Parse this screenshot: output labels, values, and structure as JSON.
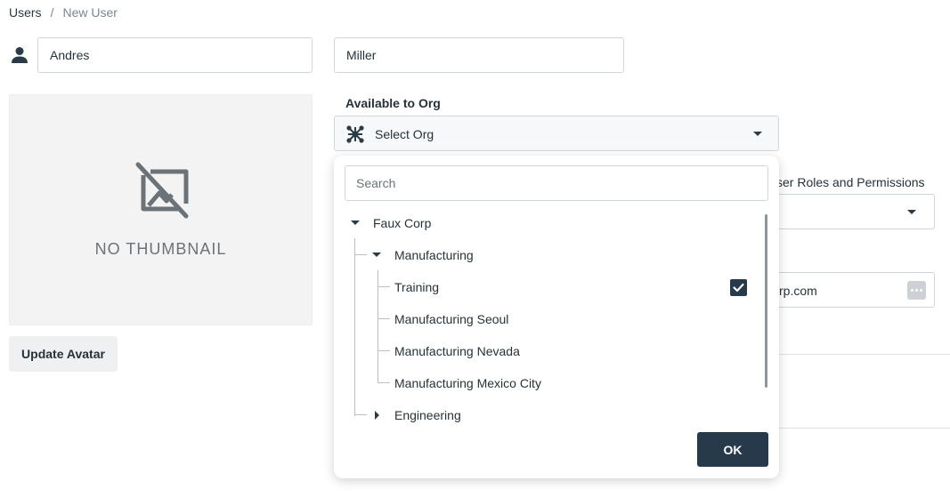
{
  "breadcrumb": {
    "root": "Users",
    "separator": "/",
    "current": "New User"
  },
  "user": {
    "first_name": "Andres",
    "last_name": "Miller"
  },
  "thumbnail": {
    "placeholder_text": "NO THUMBNAIL",
    "icon": "no-image-icon"
  },
  "avatar": {
    "update_label": "Update Avatar"
  },
  "org": {
    "label": "Available to Org",
    "select_placeholder": "Select Org",
    "icon": "org-network-icon"
  },
  "background": {
    "roles_label": "ser Roles and Permissions",
    "email_fragment": "rp.com"
  },
  "org_popup": {
    "search_placeholder": "Search",
    "tree": [
      {
        "label": "Faux Corp",
        "level": 0,
        "expanded": true,
        "checked": false
      },
      {
        "label": "Manufacturing",
        "level": 1,
        "expanded": true,
        "checked": false
      },
      {
        "label": "Training",
        "level": 2,
        "checked": true
      },
      {
        "label": "Manufacturing Seoul",
        "level": 2,
        "checked": false
      },
      {
        "label": "Manufacturing Nevada",
        "level": 2,
        "checked": false
      },
      {
        "label": "Manufacturing Mexico City",
        "level": 2,
        "checked": false
      },
      {
        "label": "Engineering",
        "level": 1,
        "expanded": false,
        "checked": false
      }
    ],
    "ok_label": "OK"
  },
  "colors": {
    "primary": "#263a4b",
    "border": "#cfd6dc",
    "thumbnail_bg": "#f3f3f3"
  }
}
